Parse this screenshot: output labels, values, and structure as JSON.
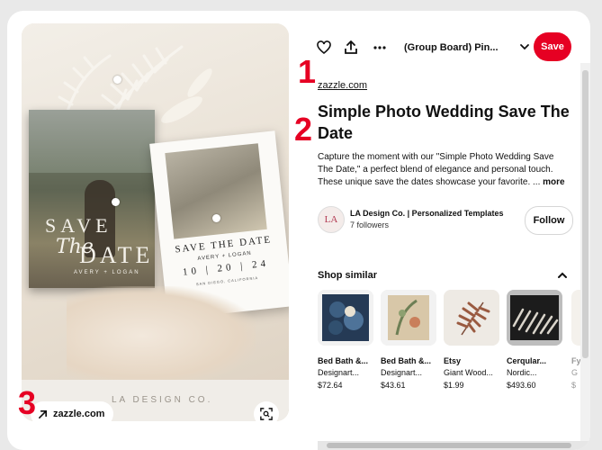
{
  "pin_image": {
    "card_text": {
      "save": "SAVE",
      "the": "The",
      "date": "DATE",
      "names": "AVERY + LOGAN",
      "white_title": "SAVE THE DATE",
      "white_names": "AVERY + LOGAN",
      "white_date": "10 | 20 | 24",
      "white_location": "SAN DIEGO, CALIFORNIA"
    },
    "brand_watermark": "LA DESIGN CO.",
    "link_chip_label": "zazzle.com",
    "link_icon": "arrow-up-right-icon",
    "lens_icon": "visual-search-icon"
  },
  "annotations": {
    "one": "1",
    "two": "2",
    "three": "3"
  },
  "toolbar": {
    "like_icon": "heart-icon",
    "share_icon": "share-icon",
    "more_icon": "more-dots-icon",
    "board_label": "(Group Board) Pin...",
    "dropdown_icon": "chevron-down-icon",
    "save_label": "Save"
  },
  "pin": {
    "domain": "zazzle.com",
    "title": "Simple Photo Wedding Save The Date",
    "description": "Capture the moment with our \"Simple Photo Wedding Save The Date,\" a perfect blend of elegance and personal touch. These unique save the dates showcase your favorite. ...",
    "more_label": "more"
  },
  "creator": {
    "avatar_text": "LA",
    "name": "LA Design Co. | Personalized Templates",
    "followers": "7 followers",
    "follow_label": "Follow"
  },
  "shop_similar": {
    "heading": "Shop similar",
    "collapse_icon": "chevron-up-icon",
    "products": [
      {
        "merchant": "Bed Bath &...",
        "name": "Designart...",
        "price": "$72.64"
      },
      {
        "merchant": "Bed Bath &...",
        "name": "Designart...",
        "price": "$43.61"
      },
      {
        "merchant": "Etsy",
        "name": "Giant Wood...",
        "price": "$1.99"
      },
      {
        "merchant": "Cerqular...",
        "name": "Nordic...",
        "price": "$493.60"
      },
      {
        "merchant": "Fy",
        "name": "G",
        "price": "$"
      }
    ]
  },
  "colors": {
    "accent": "#e60023",
    "annotation": "#e60023"
  }
}
